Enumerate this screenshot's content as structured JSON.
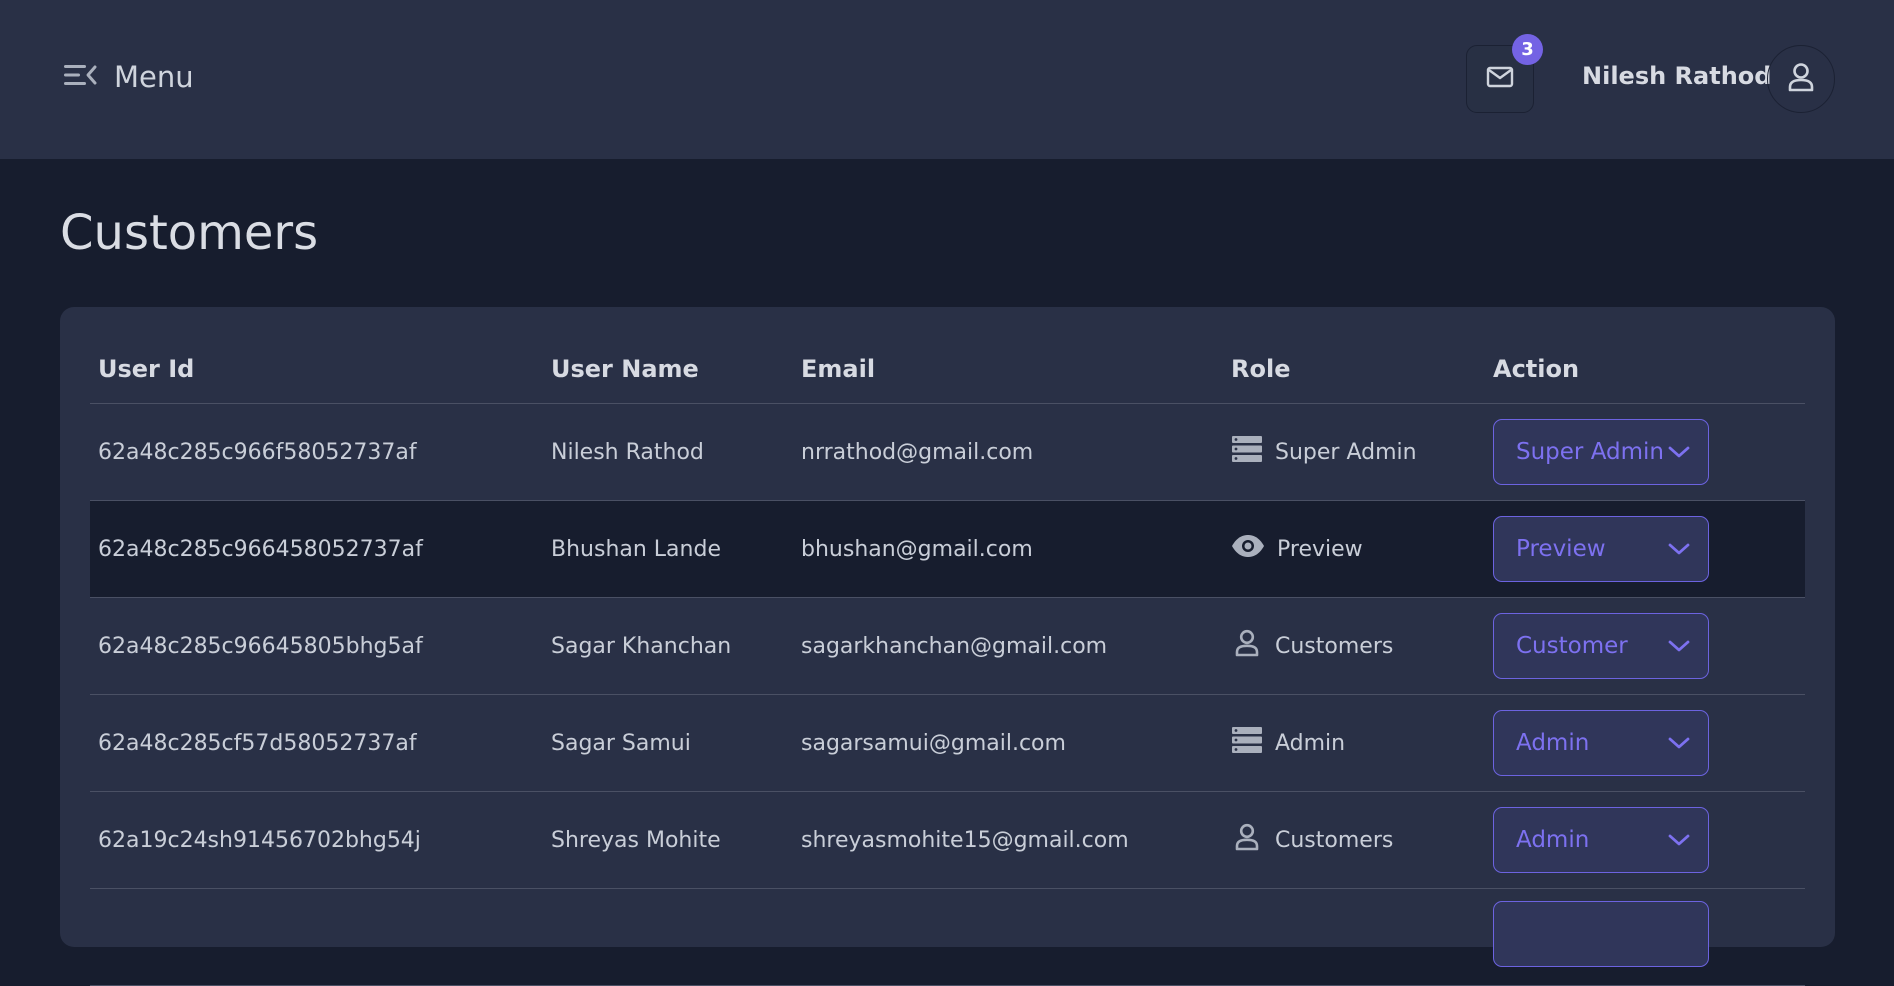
{
  "header": {
    "menu_label": "Menu",
    "notification_count": "3",
    "user_name": "Nilesh Rathod",
    "menu_icon": "menu-collapse-icon",
    "mail_icon": "mail-icon",
    "avatar_icon": "user-icon"
  },
  "page": {
    "title": "Customers"
  },
  "table": {
    "columns": [
      "User Id",
      "User Name",
      "Email",
      "Role",
      "Action"
    ],
    "rows": [
      {
        "id": "62a48c285c966f58052737af",
        "name": "Nilesh Rathod",
        "email": "nrrathod@gmail.com",
        "role": "Super Admin",
        "role_icon": "server-icon",
        "action": "Super Admin"
      },
      {
        "id": "62a48c285c966458052737af",
        "name": "Bhushan Lande",
        "email": "bhushan@gmail.com",
        "role": "Preview",
        "role_icon": "eye-icon",
        "action": "Preview"
      },
      {
        "id": "62a48c285c96645805bhg5af",
        "name": "Sagar Khanchan",
        "email": "sagarkhanchan@gmail.com",
        "role": "Customers",
        "role_icon": "user-icon",
        "action": "Customer"
      },
      {
        "id": "62a48c285cf57d58052737af",
        "name": "Sagar Samui",
        "email": "sagarsamui@gmail.com",
        "role": "Admin",
        "role_icon": "server-icon",
        "action": "Admin"
      },
      {
        "id": "62a19c24sh91456702bhg54j",
        "name": "Shreyas Mohite",
        "email": "shreyasmohite15@gmail.com",
        "role": "Customers",
        "role_icon": "user-icon",
        "action": "Admin"
      }
    ]
  },
  "colors": {
    "background": "#171d2e",
    "surface": "#293046",
    "accent": "#7463e4",
    "select_text": "#7d71f0"
  }
}
